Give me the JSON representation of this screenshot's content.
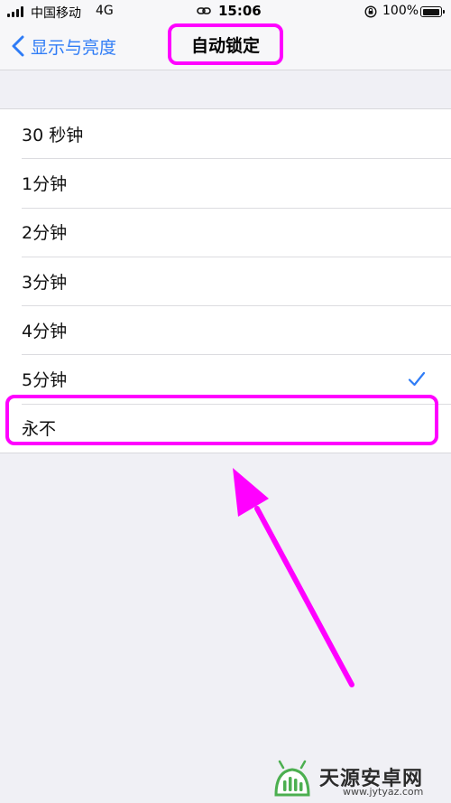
{
  "status_bar": {
    "carrier": "中国移动",
    "network": "4G",
    "time": "15:06",
    "battery": "100%",
    "battery_level": 1.0
  },
  "nav": {
    "back_label": "显示与亮度",
    "title": "自动锁定"
  },
  "options": [
    {
      "label": "30 秒钟",
      "selected": false
    },
    {
      "label": "1分钟",
      "selected": false
    },
    {
      "label": "2分钟",
      "selected": false
    },
    {
      "label": "3分钟",
      "selected": false
    },
    {
      "label": "4分钟",
      "selected": false
    },
    {
      "label": "5分钟",
      "selected": true
    },
    {
      "label": "永不",
      "selected": false
    }
  ],
  "colors": {
    "accent": "#2f7cf6",
    "highlight": "#ff00ff"
  },
  "watermark": {
    "text": "天源安卓网",
    "url": "www.jytyaz.com"
  }
}
